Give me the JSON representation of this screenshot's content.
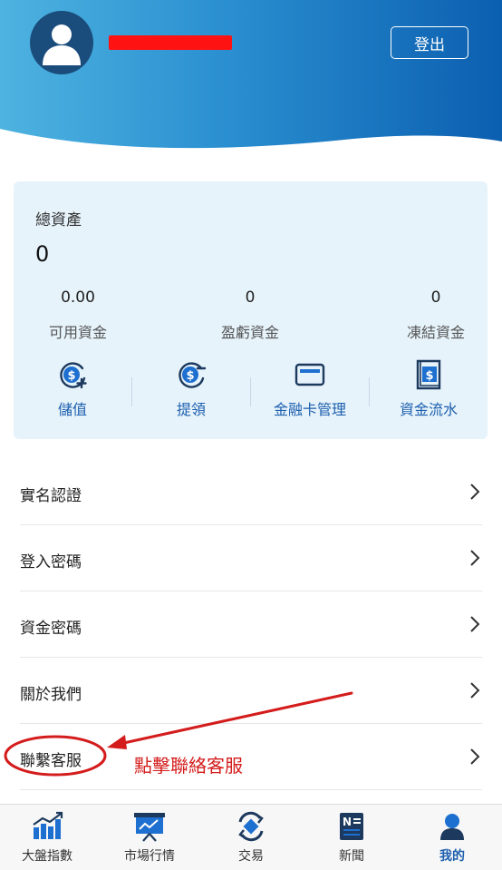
{
  "header": {
    "logout_label": "登出"
  },
  "assets": {
    "title": "總資產",
    "total": "0",
    "stats": [
      {
        "value": "0.00",
        "label": "可用資金"
      },
      {
        "value": "0",
        "label": "盈虧資金"
      },
      {
        "value": "0",
        "label": "凍結資金"
      }
    ],
    "actions": [
      {
        "label": "儲值",
        "icon": "dollar-plus-icon"
      },
      {
        "label": "提領",
        "icon": "dollar-minus-icon"
      },
      {
        "label": "金融卡管理",
        "icon": "card-icon"
      },
      {
        "label": "資金流水",
        "icon": "ledger-icon"
      }
    ]
  },
  "menu": {
    "items": [
      {
        "label": "實名認證"
      },
      {
        "label": "登入密碼"
      },
      {
        "label": "資金密碼"
      },
      {
        "label": "關於我們"
      },
      {
        "label": "聯繫客服"
      }
    ]
  },
  "annotation": {
    "text": "點擊聯絡客服",
    "color": "#d41c1c"
  },
  "tabbar": {
    "items": [
      {
        "label": "大盤指數",
        "icon": "bar-chart-icon"
      },
      {
        "label": "市場行情",
        "icon": "presentation-chart-icon"
      },
      {
        "label": "交易",
        "icon": "exchange-icon"
      },
      {
        "label": "新聞",
        "icon": "news-icon"
      },
      {
        "label": "我的",
        "icon": "user-icon",
        "active": true
      }
    ]
  },
  "colors": {
    "accent": "#1d5fae",
    "card_bg": "#e6f3fb",
    "header_dark": "#0c5fb0",
    "header_light": "#4eb3e0"
  }
}
